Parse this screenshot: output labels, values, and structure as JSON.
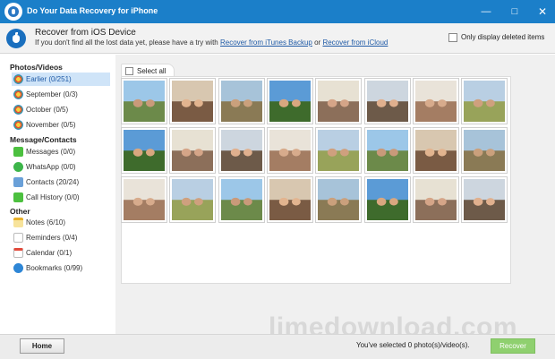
{
  "window": {
    "title": "Do Your Data Recovery for iPhone",
    "controls": {
      "minimize": "—",
      "maximize": "□",
      "close": "✕"
    }
  },
  "header": {
    "title": "Recover from iOS Device",
    "subtitle_prefix": "If you don't find all the lost data yet, please have a try with",
    "link_itunes": "Recover from iTunes Backup",
    "subtitle_or": "or",
    "link_icloud": "Recover from iCloud",
    "only_deleted_label": "Only display deleted items"
  },
  "sidebar": {
    "categories": [
      {
        "title": "Photos/Videos",
        "items": [
          {
            "label": "Earlier (0/251)",
            "icon": "photos-icon",
            "selected": true
          },
          {
            "label": "September (0/3)",
            "icon": "photos-icon"
          },
          {
            "label": "October (0/5)",
            "icon": "photos-icon"
          },
          {
            "label": "November (0/5)",
            "icon": "photos-icon"
          }
        ]
      },
      {
        "title": "Message/Contacts",
        "items": [
          {
            "label": "Messages (0/0)",
            "icon": "messages-icon"
          },
          {
            "label": "WhatsApp (0/0)",
            "icon": "whatsapp-icon"
          },
          {
            "label": "Contacts (20/24)",
            "icon": "contacts-icon"
          },
          {
            "label": "Call History (0/0)",
            "icon": "call-history-icon"
          }
        ]
      },
      {
        "title": "Other",
        "items": [
          {
            "label": "Notes (6/10)",
            "icon": "notes-icon"
          },
          {
            "label": "Reminders (0/4)",
            "icon": "reminders-icon"
          },
          {
            "label": "Calendar (0/1)",
            "icon": "calendar-icon"
          },
          {
            "label": "Bookmarks (0/99)",
            "icon": "bookmarks-icon"
          }
        ]
      }
    ]
  },
  "content": {
    "select_all_label": "Select all",
    "thumbnail_rows": 3,
    "thumbnail_cols": 8
  },
  "footer": {
    "home_label": "Home",
    "status": "You've selected 0 photo(s)/video(s).",
    "recover_label": "Recover"
  },
  "watermark": "limedownload.com",
  "colors": {
    "titlebar": "#1b7fc9",
    "selected_bg": "#cfe4f8",
    "link": "#1f5aa6",
    "recover_button": "#8fd06f"
  }
}
